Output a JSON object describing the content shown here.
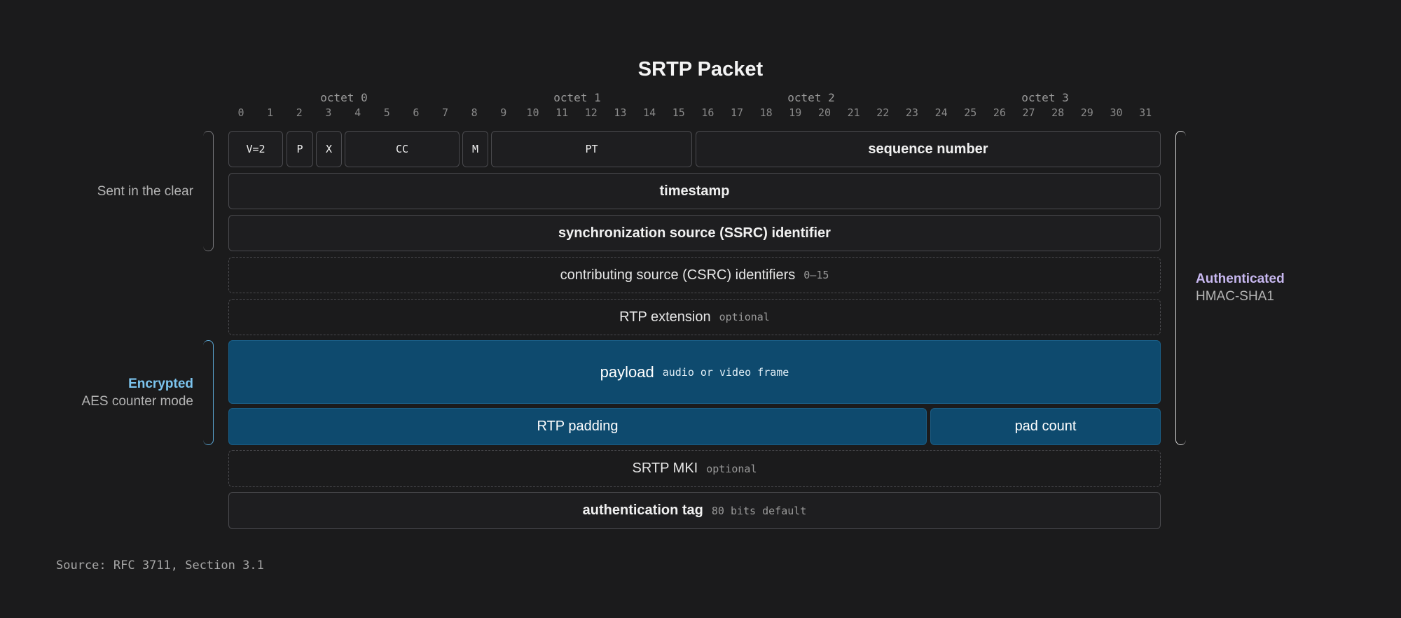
{
  "title": "SRTP Packet",
  "octets": [
    "octet 0",
    "octet 1",
    "octet 2",
    "octet 3"
  ],
  "bit_numbers": [
    "0",
    "1",
    "2",
    "3",
    "4",
    "5",
    "6",
    "7",
    "8",
    "9",
    "10",
    "11",
    "12",
    "13",
    "14",
    "15",
    "16",
    "17",
    "18",
    "19",
    "20",
    "21",
    "22",
    "23",
    "24",
    "25",
    "26",
    "27",
    "28",
    "29",
    "30",
    "31"
  ],
  "fields": {
    "version": "V=2",
    "padding_flag": "P",
    "extension_flag": "X",
    "csrc_count": "CC",
    "marker": "M",
    "payload_type": "PT",
    "sequence_number": "sequence number",
    "timestamp": "timestamp",
    "ssrc": "synchronization source (SSRC) identifier",
    "csrc": {
      "name": "contributing source (CSRC) identifiers",
      "note": "0–15"
    },
    "rtp_extension": {
      "name": "RTP extension",
      "note": "optional"
    },
    "payload": {
      "name": "payload",
      "note": "audio or video frame"
    },
    "rtp_padding": "RTP padding",
    "pad_count": "pad count",
    "srtp_mki": {
      "name": "SRTP MKI",
      "note": "optional"
    },
    "auth_tag": {
      "name": "authentication tag",
      "note": "80 bits default"
    }
  },
  "regions": {
    "clear": {
      "label": "Sent in the clear"
    },
    "encrypted": {
      "label": "Encrypted",
      "sublabel": "AES counter mode",
      "color": "#7cc4ee"
    },
    "authenticated": {
      "label": "Authenticated",
      "sublabel": "HMAC-SHA1",
      "color": "#c8b8f0"
    }
  },
  "colors": {
    "background": "#1b1b1c",
    "encrypted_fill": "#0e4a6e",
    "field_border": "#4a4a4e"
  },
  "source": "Source: RFC 3711, Section 3.1"
}
